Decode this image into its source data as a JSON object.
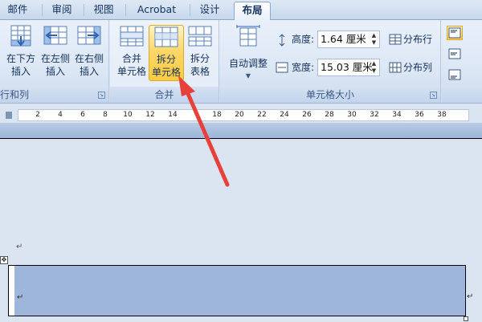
{
  "tabs": [
    "邮件",
    "审阅",
    "视图",
    "Acrobat",
    "设计",
    "布局"
  ],
  "active_tab": "布局",
  "groups": {
    "rows_cols": {
      "label": "行和列",
      "buttons": [
        {
          "line1": "在下方",
          "line2": "插入",
          "icon": "insert-below-icon"
        },
        {
          "line1": "在左侧",
          "line2": "插入",
          "icon": "insert-left-icon"
        },
        {
          "line1": "在右侧",
          "line2": "插入",
          "icon": "insert-right-icon"
        }
      ]
    },
    "merge": {
      "label": "合并",
      "buttons": [
        {
          "line1": "合并",
          "line2": "单元格",
          "icon": "merge-cells-icon"
        },
        {
          "line1": "拆分",
          "line2": "单元格",
          "icon": "split-cells-icon"
        },
        {
          "line1": "拆分",
          "line2": "表格",
          "icon": "split-table-icon"
        }
      ]
    },
    "cell_size": {
      "label": "单元格大小",
      "autofit_label": "自动调整",
      "height_label": "高度:",
      "height_value": "1.64 厘米",
      "width_label": "宽度:",
      "width_value": "15.03 厘米",
      "distribute_rows": "分布行",
      "distribute_cols": "分布列"
    }
  },
  "ruler": {
    "labels": [
      "2",
      "4",
      "6",
      "8",
      "10",
      "12",
      "14",
      "18",
      "20",
      "22",
      "24",
      "26",
      "28",
      "30",
      "32",
      "34",
      "36",
      "38"
    ]
  },
  "document": {
    "paragraph_mark": "↵"
  },
  "colors": {
    "highlight": "#ffd86a",
    "arrow": "#e8413c",
    "cell_selection": "#9eb6da"
  }
}
